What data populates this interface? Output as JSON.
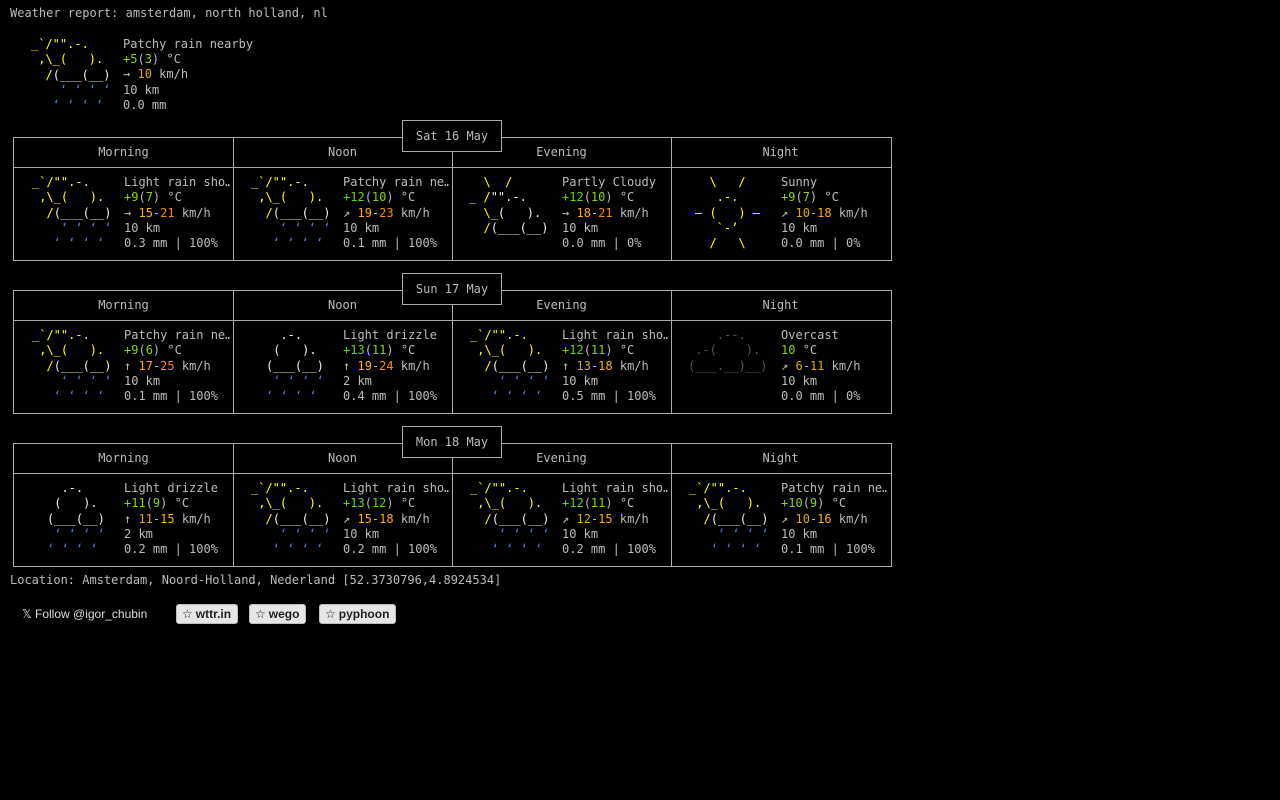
{
  "header": {
    "title": "Weather report: amsterdam, north holland, nl"
  },
  "current": {
    "condition": "Patchy rain nearby",
    "temp": "+5",
    "feels": "3",
    "temp_unit": "°C",
    "wind_arrow": "→",
    "wind": "10",
    "wind_unit": "km/h",
    "visibility": "10 km",
    "precip": "0.0 mm",
    "icon": "patchy-rain-icon"
  },
  "periods": [
    "Morning",
    "Noon",
    "Evening",
    "Night"
  ],
  "days": [
    {
      "date": "Sat 16 May",
      "cells": [
        {
          "icon": "light-rain-icon",
          "condition": "Light rain sho…",
          "temp": "+9",
          "feels": "7",
          "unit": "°C",
          "arrow": "→",
          "wind_lo": "15",
          "wind_hi": "21",
          "wind_unit": "km/h",
          "visibility": "10 km",
          "precip": "0.3 mm | 100%"
        },
        {
          "icon": "patchy-rain-icon",
          "condition": "Patchy rain ne…",
          "temp": "+12",
          "feels": "10",
          "unit": "°C",
          "arrow": "↗",
          "wind_lo": "19",
          "wind_hi": "23",
          "wind_unit": "km/h",
          "visibility": "10 km",
          "precip": "0.1 mm | 100%"
        },
        {
          "icon": "partly-cloudy-icon",
          "condition": "Partly Cloudy",
          "temp": "+12",
          "feels": "10",
          "unit": "°C",
          "arrow": "→",
          "wind_lo": "18",
          "wind_hi": "21",
          "wind_unit": "km/h",
          "visibility": "10 km",
          "precip": "0.0 mm | 0%"
        },
        {
          "icon": "sunny-icon",
          "condition": "Sunny",
          "temp": "+9",
          "feels": "7",
          "unit": "°C",
          "arrow": "↗",
          "wind_lo": "10",
          "wind_hi": "18",
          "wind_unit": "km/h",
          "visibility": "10 km",
          "precip": "0.0 mm | 0%"
        }
      ]
    },
    {
      "date": "Sun 17 May",
      "cells": [
        {
          "icon": "patchy-rain-icon",
          "condition": "Patchy rain ne…",
          "temp": "+9",
          "feels": "6",
          "unit": "°C",
          "arrow": "↑",
          "wind_lo": "17",
          "wind_hi": "25",
          "wind_unit": "km/h",
          "visibility": "10 km",
          "precip": "0.1 mm | 100%"
        },
        {
          "icon": "light-drizzle-icon",
          "condition": "Light drizzle",
          "temp": "+13",
          "feels": "11",
          "unit": "°C",
          "arrow": "↑",
          "wind_lo": "19",
          "wind_hi": "24",
          "wind_unit": "km/h",
          "visibility": "2 km",
          "precip": "0.4 mm | 100%"
        },
        {
          "icon": "light-rain-icon",
          "condition": "Light rain sho…",
          "temp": "+12",
          "feels": "11",
          "unit": "°C",
          "arrow": "↑",
          "wind_lo": "13",
          "wind_hi": "18",
          "wind_unit": "km/h",
          "visibility": "10 km",
          "precip": "0.5 mm | 100%"
        },
        {
          "icon": "overcast-icon",
          "condition": "Overcast",
          "temp": "10",
          "feels": "",
          "unit": "°C",
          "arrow": "↗",
          "wind_lo": "6",
          "wind_hi": "11",
          "wind_unit": "km/h",
          "visibility": "10 km",
          "precip": "0.0 mm | 0%"
        }
      ]
    },
    {
      "date": "Mon 18 May",
      "cells": [
        {
          "icon": "light-drizzle-icon",
          "condition": "Light drizzle",
          "temp": "+11",
          "feels": "9",
          "unit": "°C",
          "arrow": "↑",
          "wind_lo": "11",
          "wind_hi": "15",
          "wind_unit": "km/h",
          "visibility": "2 km",
          "precip": "0.2 mm | 100%"
        },
        {
          "icon": "light-rain-icon",
          "condition": "Light rain sho…",
          "temp": "+13",
          "feels": "12",
          "unit": "°C",
          "arrow": "↗",
          "wind_lo": "15",
          "wind_hi": "18",
          "wind_unit": "km/h",
          "visibility": "10 km",
          "precip": "0.2 mm | 100%"
        },
        {
          "icon": "light-rain-icon",
          "condition": "Light rain sho…",
          "temp": "+12",
          "feels": "11",
          "unit": "°C",
          "arrow": "↗",
          "wind_lo": "12",
          "wind_hi": "15",
          "wind_unit": "km/h",
          "visibility": "10 km",
          "precip": "0.2 mm | 100%"
        },
        {
          "icon": "patchy-rain-icon",
          "condition": "Patchy rain ne…",
          "temp": "+10",
          "feels": "9",
          "unit": "°C",
          "arrow": "↗",
          "wind_lo": "10",
          "wind_hi": "16",
          "wind_unit": "km/h",
          "visibility": "10 km",
          "precip": "0.1 mm | 100%"
        }
      ]
    }
  ],
  "location": "Location: Amsterdam, Noord-Holland, Nederland [52.3730796,4.8924534]",
  "footer": {
    "follow": "Follow @igor_chubin",
    "buttons": [
      "wttr.in",
      "wego",
      "pyphoon"
    ]
  }
}
